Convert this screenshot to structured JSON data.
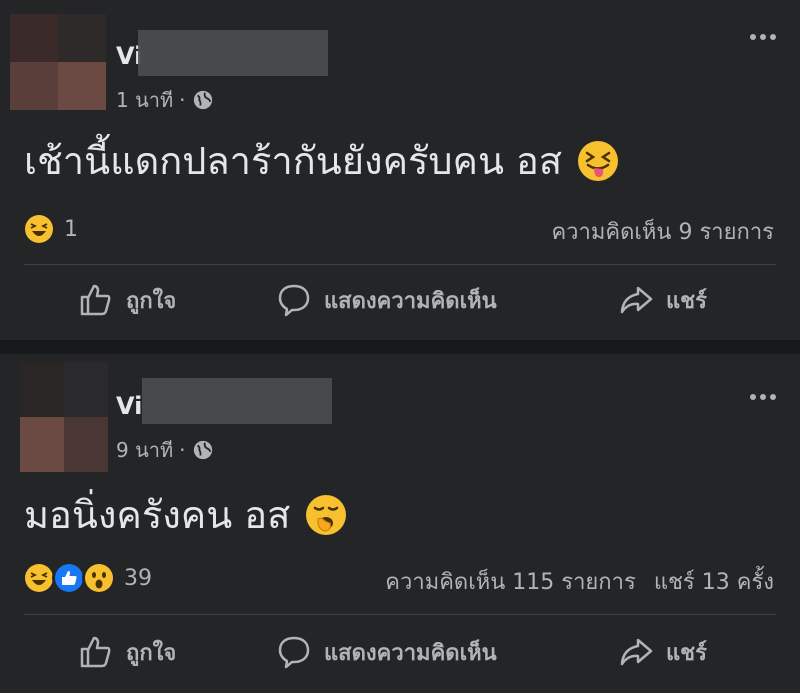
{
  "posts": [
    {
      "author": "Vi",
      "time": "1 นาที",
      "separator": "·",
      "text": "เช้านี้แดกปลาร้ากันยังครับคน อส",
      "text_emoji": "squinting-face-with-tongue",
      "reaction_icons": [
        "haha"
      ],
      "reaction_count": "1",
      "comments": "ความคิดเห็น 9 รายการ",
      "shares": "",
      "actions": {
        "like": "ถูกใจ",
        "comment": "แสดงความคิดเห็น",
        "share": "แชร์"
      }
    },
    {
      "author": "Vi",
      "time": "9 นาที",
      "separator": "·",
      "text": "มอนิ่งครังคน อส",
      "text_emoji": "yawning-face",
      "reaction_icons": [
        "haha",
        "like",
        "wow"
      ],
      "reaction_count": "39",
      "comments": "ความคิดเห็น 115 รายการ",
      "shares": "แชร์ 13 ครั้ง",
      "actions": {
        "like": "ถูกใจ",
        "comment": "แสดงความคิดเห็น",
        "share": "แชร์"
      }
    }
  ],
  "colors": {
    "background": "#18191a",
    "card": "#242526",
    "text_primary": "#e4e6eb",
    "text_secondary": "#b0b3b8",
    "like_blue": "#1877f2",
    "emoji_yellow": "#f7c02f"
  }
}
